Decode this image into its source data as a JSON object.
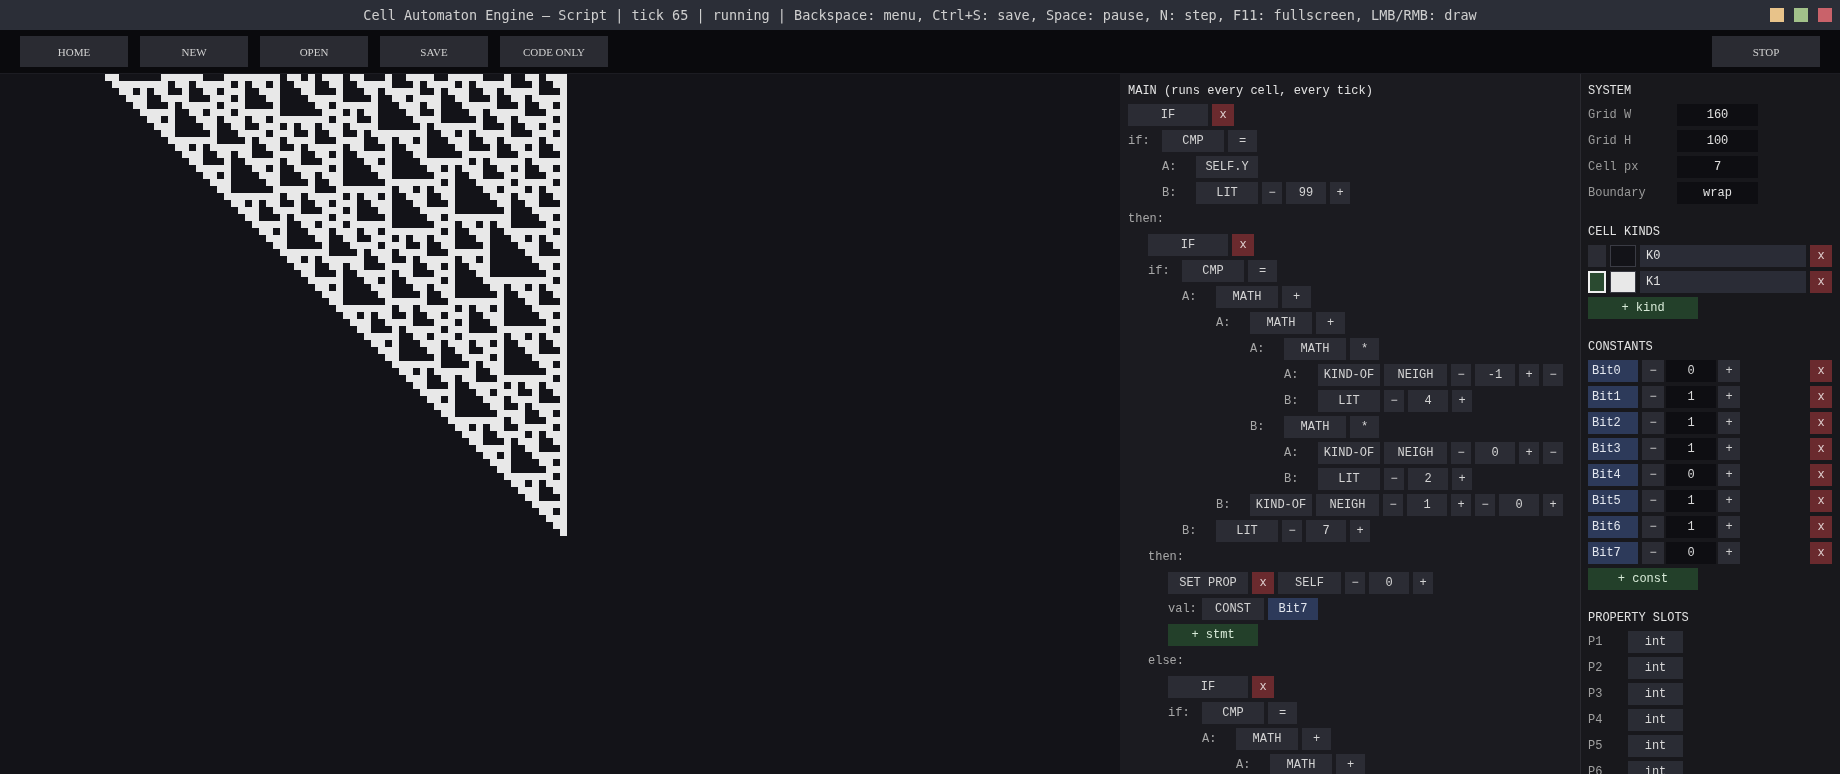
{
  "window": {
    "title": "Cell Automaton Engine — Script | tick 65 | running | Backspace: menu, Ctrl+S: save, Space: pause, N: step, F11: fullscreen, LMB/RMB: draw"
  },
  "toolbar": {
    "left_buttons": [
      "HOME",
      "NEW",
      "OPEN",
      "SAVE",
      "CODE ONLY"
    ],
    "right_buttons": [
      "STOP"
    ]
  },
  "script": {
    "title": "MAIN (runs every cell, every tick)",
    "rows": [
      {
        "tokens": [
          {
            "kind": "head",
            "text": "IF"
          },
          {
            "kind": "delete",
            "text": "x"
          }
        ]
      },
      {
        "label": "if:",
        "tokens": [
          {
            "kind": "node",
            "text": "CMP"
          },
          {
            "kind": "op",
            "text": "="
          }
        ],
        "children": [
          {
            "label": "A:",
            "tokens": [
              {
                "kind": "node",
                "text": "SELF.Y"
              }
            ]
          },
          {
            "label": "B:",
            "tokens": [
              {
                "kind": "node",
                "text": "LIT"
              },
              {
                "kind": "dec",
                "text": "−"
              },
              {
                "kind": "value",
                "text": "99"
              },
              {
                "kind": "inc",
                "text": "+"
              }
            ]
          }
        ]
      },
      {
        "label": "then:",
        "children": [
          {
            "tokens": [
              {
                "kind": "head",
                "text": "IF"
              },
              {
                "kind": "delete",
                "text": "x"
              }
            ]
          },
          {
            "label": "if:",
            "tokens": [
              {
                "kind": "node",
                "text": "CMP"
              },
              {
                "kind": "op",
                "text": "="
              }
            ],
            "children": [
              {
                "label": "A:",
                "tokens": [
                  {
                    "kind": "node",
                    "text": "MATH"
                  },
                  {
                    "kind": "op",
                    "text": "+"
                  }
                ],
                "children": [
                  {
                    "label": "A:",
                    "tokens": [
                      {
                        "kind": "node",
                        "text": "MATH"
                      },
                      {
                        "kind": "op",
                        "text": "+"
                      }
                    ],
                    "children": [
                      {
                        "label": "A:",
                        "tokens": [
                          {
                            "kind": "node",
                            "text": "MATH"
                          },
                          {
                            "kind": "op",
                            "text": "*"
                          }
                        ],
                        "children": [
                          {
                            "label": "A:",
                            "tokens": [
                              {
                                "kind": "node",
                                "text": "KIND-OF"
                              },
                              {
                                "kind": "target",
                                "text": "NEIGH"
                              },
                              {
                                "kind": "dec",
                                "text": "−"
                              },
                              {
                                "kind": "value",
                                "text": "-1"
                              },
                              {
                                "kind": "inc",
                                "text": "+"
                              },
                              {
                                "kind": "dec",
                                "text": "−"
                              }
                            ]
                          },
                          {
                            "label": "B:",
                            "tokens": [
                              {
                                "kind": "node",
                                "text": "LIT"
                              },
                              {
                                "kind": "dec",
                                "text": "−"
                              },
                              {
                                "kind": "value",
                                "text": "4"
                              },
                              {
                                "kind": "inc",
                                "text": "+"
                              }
                            ]
                          }
                        ]
                      },
                      {
                        "label": "B:",
                        "tokens": [
                          {
                            "kind": "node",
                            "text": "MATH"
                          },
                          {
                            "kind": "op",
                            "text": "*"
                          }
                        ],
                        "children": [
                          {
                            "label": "A:",
                            "tokens": [
                              {
                                "kind": "node",
                                "text": "KIND-OF"
                              },
                              {
                                "kind": "target",
                                "text": "NEIGH"
                              },
                              {
                                "kind": "dec",
                                "text": "−"
                              },
                              {
                                "kind": "value",
                                "text": "0"
                              },
                              {
                                "kind": "inc",
                                "text": "+"
                              },
                              {
                                "kind": "dec",
                                "text": "−"
                              }
                            ]
                          },
                          {
                            "label": "B:",
                            "tokens": [
                              {
                                "kind": "node",
                                "text": "LIT"
                              },
                              {
                                "kind": "dec",
                                "text": "−"
                              },
                              {
                                "kind": "value",
                                "text": "2"
                              },
                              {
                                "kind": "inc",
                                "text": "+"
                              }
                            ]
                          }
                        ]
                      }
                    ]
                  },
                  {
                    "label": "B:",
                    "tokens": [
                      {
                        "kind": "node",
                        "text": "KIND-OF"
                      },
                      {
                        "kind": "target",
                        "text": "NEIGH"
                      },
                      {
                        "kind": "dec",
                        "text": "−"
                      },
                      {
                        "kind": "value",
                        "text": "1"
                      },
                      {
                        "kind": "inc",
                        "text": "+"
                      },
                      {
                        "kind": "dec",
                        "text": "−"
                      },
                      {
                        "kind": "value",
                        "text": "0"
                      },
                      {
                        "kind": "inc",
                        "text": "+"
                      }
                    ]
                  }
                ]
              },
              {
                "label": "B:",
                "tokens": [
                  {
                    "kind": "node",
                    "text": "LIT"
                  },
                  {
                    "kind": "dec",
                    "text": "−"
                  },
                  {
                    "kind": "value",
                    "text": "7"
                  },
                  {
                    "kind": "inc",
                    "text": "+"
                  }
                ]
              }
            ]
          },
          {
            "label": "then:",
            "children": [
              {
                "tokens": [
                  {
                    "kind": "head",
                    "text": "SET PROP"
                  },
                  {
                    "kind": "delete",
                    "text": "x"
                  },
                  {
                    "kind": "target",
                    "text": "SELF"
                  },
                  {
                    "kind": "dec",
                    "text": "−"
                  },
                  {
                    "kind": "value",
                    "text": "0"
                  },
                  {
                    "kind": "inc",
                    "text": "+"
                  }
                ]
              },
              {
                "label": "val:",
                "tokens": [
                  {
                    "kind": "node",
                    "text": "CONST"
                  },
                  {
                    "kind": "const",
                    "text": "Bit7"
                  }
                ]
              },
              {
                "tokens": [
                  {
                    "kind": "add",
                    "text": "+ stmt"
                  }
                ]
              }
            ]
          },
          {
            "label": "else:",
            "children": [
              {
                "tokens": [
                  {
                    "kind": "head",
                    "text": "IF"
                  },
                  {
                    "kind": "delete",
                    "text": "x"
                  }
                ]
              },
              {
                "label": "if:",
                "tokens": [
                  {
                    "kind": "node",
                    "text": "CMP"
                  },
                  {
                    "kind": "op",
                    "text": "="
                  }
                ],
                "children": [
                  {
                    "label": "A:",
                    "tokens": [
                      {
                        "kind": "node",
                        "text": "MATH"
                      },
                      {
                        "kind": "op",
                        "text": "+"
                      }
                    ],
                    "children": [
                      {
                        "label": "A:",
                        "tokens": [
                          {
                            "kind": "node",
                            "text": "MATH"
                          },
                          {
                            "kind": "op",
                            "text": "+"
                          }
                        ]
                      }
                    ]
                  }
                ]
              }
            ]
          }
        ]
      }
    ]
  },
  "system": {
    "title": "SYSTEM",
    "fields": [
      {
        "label": "Grid W",
        "value": "160"
      },
      {
        "label": "Grid H",
        "value": "100"
      },
      {
        "label": "Cell px",
        "value": "7"
      },
      {
        "label": "Boundary",
        "value": "wrap"
      }
    ]
  },
  "cell_kinds": {
    "title": "CELL KINDS",
    "items": [
      {
        "name": "K0",
        "color": "#131318",
        "selected": false,
        "delete": "x"
      },
      {
        "name": "K1",
        "color": "#e8e8e8",
        "selected": true,
        "delete": "x"
      }
    ],
    "add_button": "+ kind"
  },
  "constants": {
    "title": "CONSTANTS",
    "items": [
      {
        "name": "Bit0",
        "dec": "−",
        "value": "0",
        "inc": "+",
        "delete": "x"
      },
      {
        "name": "Bit1",
        "dec": "−",
        "value": "1",
        "inc": "+",
        "delete": "x"
      },
      {
        "name": "Bit2",
        "dec": "−",
        "value": "1",
        "inc": "+",
        "delete": "x"
      },
      {
        "name": "Bit3",
        "dec": "−",
        "value": "1",
        "inc": "+",
        "delete": "x"
      },
      {
        "name": "Bit4",
        "dec": "−",
        "value": "0",
        "inc": "+",
        "delete": "x"
      },
      {
        "name": "Bit5",
        "dec": "−",
        "value": "1",
        "inc": "+",
        "delete": "x"
      },
      {
        "name": "Bit6",
        "dec": "−",
        "value": "1",
        "inc": "+",
        "delete": "x"
      },
      {
        "name": "Bit7",
        "dec": "−",
        "value": "0",
        "inc": "+",
        "delete": "x"
      }
    ],
    "add_button": "+ const"
  },
  "property_slots": {
    "title": "PROPERTY SLOTS",
    "items": [
      {
        "name": "P1",
        "type": "int"
      },
      {
        "name": "P2",
        "type": "int"
      },
      {
        "name": "P3",
        "type": "int"
      },
      {
        "name": "P4",
        "type": "int"
      },
      {
        "name": "P5",
        "type": "int"
      },
      {
        "name": "P6",
        "type": "int"
      }
    ]
  }
}
